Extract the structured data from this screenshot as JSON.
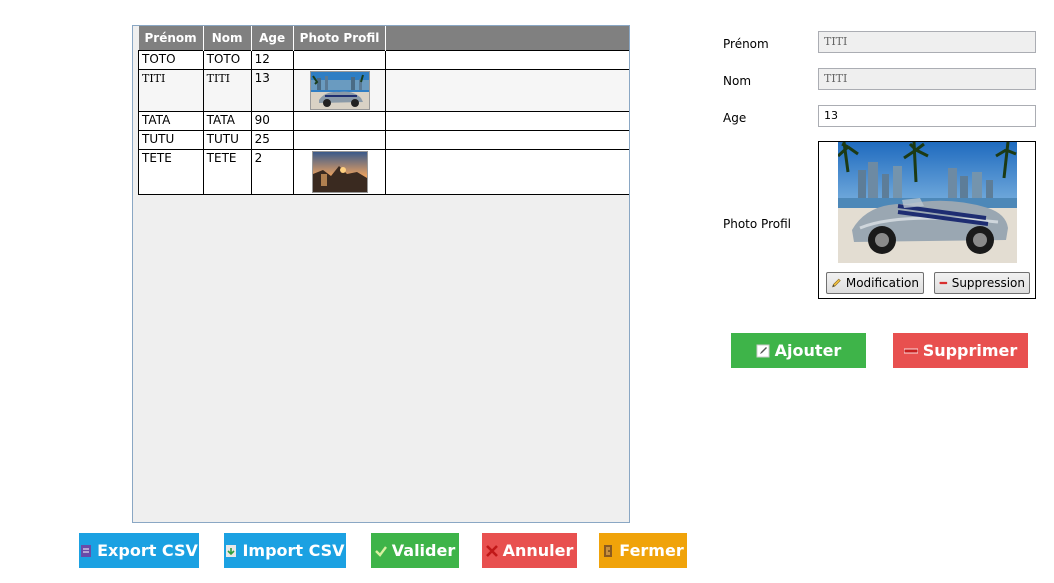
{
  "grid": {
    "headers": [
      "Prénom",
      "Nom",
      "Age",
      "Photo Profil"
    ],
    "rows": [
      {
        "prenom": "TOTO",
        "nom": "TOTO",
        "age": "12",
        "photo": ""
      },
      {
        "prenom": "TITI",
        "nom": "TITI",
        "age": "13",
        "photo": "car-image"
      },
      {
        "prenom": "TATA",
        "nom": "TATA",
        "age": "90",
        "photo": ""
      },
      {
        "prenom": "TUTU",
        "nom": "TUTU",
        "age": "25",
        "photo": ""
      },
      {
        "prenom": "TETE",
        "nom": "TETE",
        "age": "2",
        "photo": "sunset-image"
      }
    ]
  },
  "form": {
    "prenom_label": "Prénom",
    "prenom_value": "TITI",
    "nom_label": "Nom",
    "nom_value": "TITI",
    "age_label": "Age",
    "age_value": "13",
    "photo_label": "Photo Profil",
    "modify_label": "Modification",
    "delete_photo_label": "Suppression"
  },
  "actions": {
    "add_label": "Ajouter",
    "remove_label": "Supprimer"
  },
  "bottom": {
    "export_label": "Export CSV",
    "import_label": "Import CSV",
    "validate_label": "Valider",
    "cancel_label": "Annuler",
    "close_label": "Fermer"
  },
  "colors": {
    "green": "#3eb449",
    "red": "#e8504f",
    "blue": "#1ba1e2",
    "orange": "#f0a30a",
    "header_gray": "#808080"
  }
}
